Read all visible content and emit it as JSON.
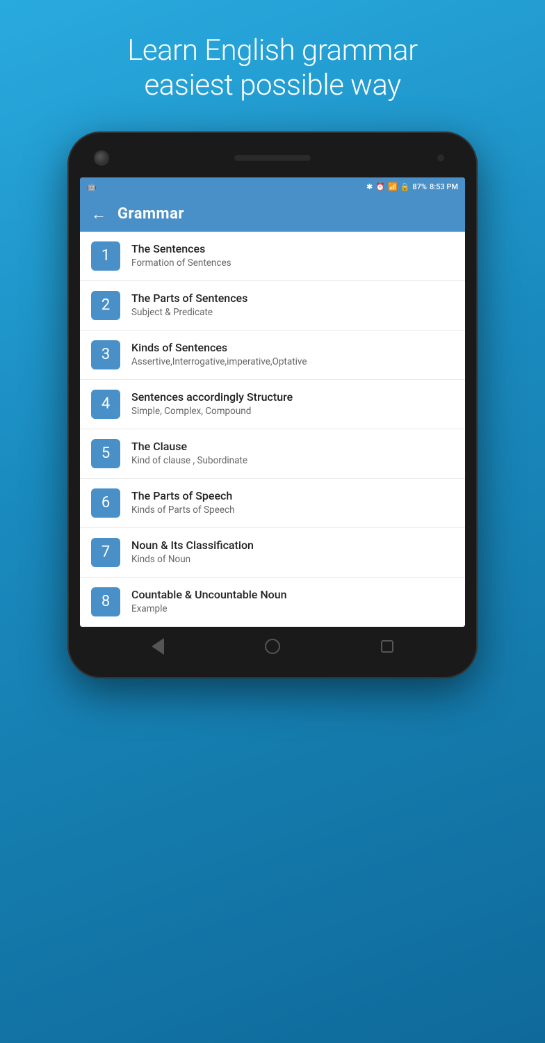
{
  "hero": {
    "line1": "Learn English grammar",
    "line2": "easiest possible way"
  },
  "status_bar": {
    "battery": "87%",
    "time": "8:53 PM"
  },
  "app": {
    "title": "Grammar",
    "back_label": "←"
  },
  "items": [
    {
      "number": "1",
      "title": "The Sentences",
      "subtitle": "Formation of Sentences"
    },
    {
      "number": "2",
      "title": "The Parts of Sentences",
      "subtitle": "Subject & Predicate"
    },
    {
      "number": "3",
      "title": "Kinds of Sentences",
      "subtitle": "Assertive,Interrogative,imperative,Optative"
    },
    {
      "number": "4",
      "title": "Sentences accordingly Structure",
      "subtitle": "Simple, Complex, Compound"
    },
    {
      "number": "5",
      "title": "The Clause",
      "subtitle": "Kind of clause , Subordinate"
    },
    {
      "number": "6",
      "title": "The Parts of Speech",
      "subtitle": "Kinds of Parts of Speech"
    },
    {
      "number": "7",
      "title": "Noun & Its Classification",
      "subtitle": "Kinds of Noun"
    },
    {
      "number": "8",
      "title": "Countable & Uncountable Noun",
      "subtitle": "Example"
    }
  ]
}
